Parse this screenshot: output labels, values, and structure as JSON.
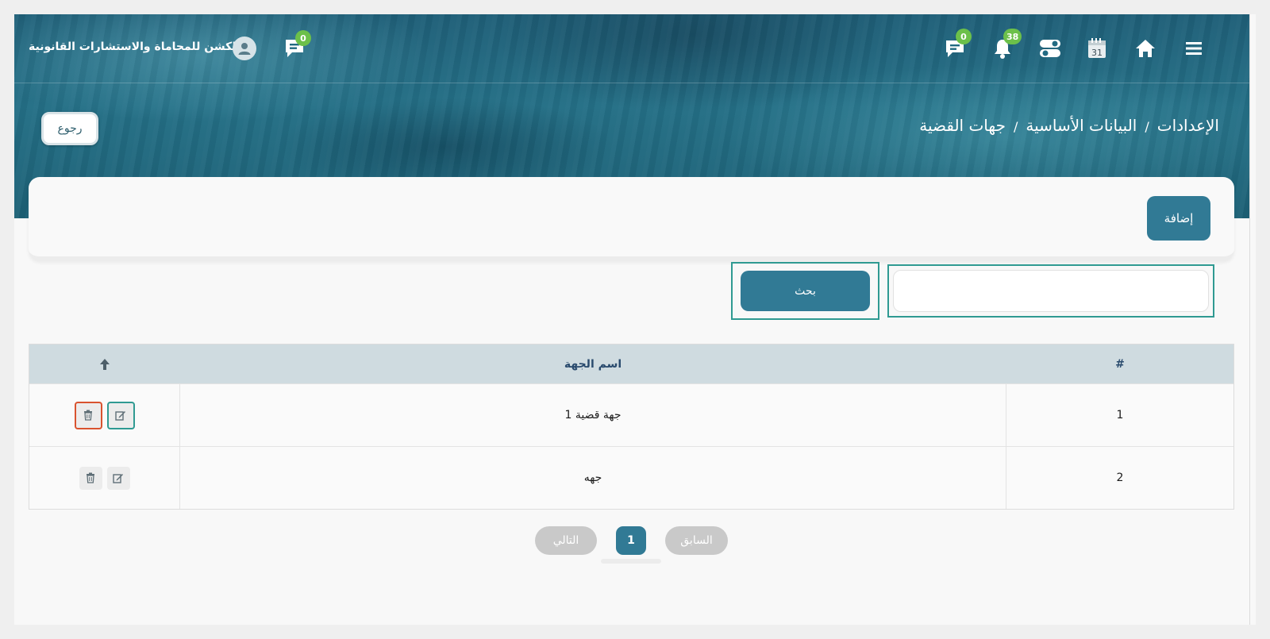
{
  "header": {
    "brand": "الكشن للمحاماة والاستشارات القانونية",
    "chat_badge_left": "0",
    "messages_badge": "0",
    "notifications_badge": "38",
    "calendar_day": "31"
  },
  "breadcrumb": {
    "items": [
      "الإعدادات",
      "البيانات الأساسية",
      "جهات القضية"
    ],
    "separator": "/"
  },
  "back_label": "رجوع",
  "add_label": "إضافة",
  "search": {
    "value": "",
    "placeholder": "",
    "button_label": "بحث"
  },
  "table": {
    "columns": [
      "#",
      "اسم الجهة"
    ],
    "rows": [
      {
        "num": "1",
        "name": "جهة قضية 1"
      },
      {
        "num": "2",
        "name": "جهه"
      }
    ]
  },
  "pagination": {
    "prev": "السابق",
    "current": "1",
    "next": "التالي"
  },
  "colors": {
    "primary": "#317a95",
    "badge": "#6cc04a",
    "outline": "#2f9a92",
    "danger": "#d9532f"
  }
}
